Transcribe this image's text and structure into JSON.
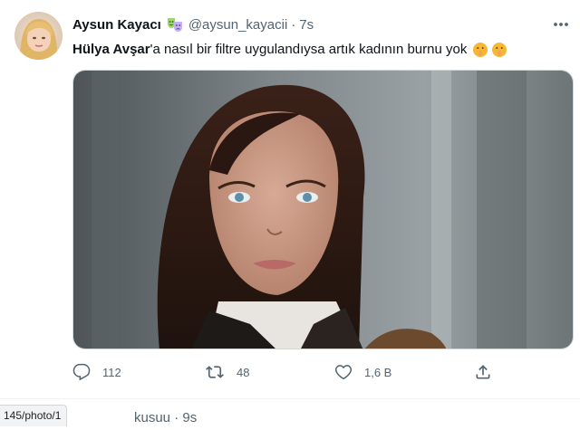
{
  "tweet": {
    "display_name": "Aysun Kayacı",
    "badge_icon": "theater-masks-icon",
    "handle": "@aysun_kayacii",
    "separator": "·",
    "time": "7s",
    "text_mention": "Hülya Avşar",
    "text_rest": "'a nasıl bir filtre uygulandıysa artık kadının burnu yok",
    "emojis": [
      "shushing-face-icon",
      "shushing-face-icon"
    ],
    "more_icon": "more-horizontal-icon",
    "actions": {
      "reply_count": "112",
      "retweet_count": "48",
      "like_count": "1,6 B"
    }
  },
  "next_tweet": {
    "handle_fragment": "kusuu · 9s"
  },
  "status_bar": {
    "url": "145/photo/1"
  },
  "colors": {
    "text_primary": "#0f1419",
    "text_secondary": "#536471",
    "border": "#eff3f4"
  }
}
